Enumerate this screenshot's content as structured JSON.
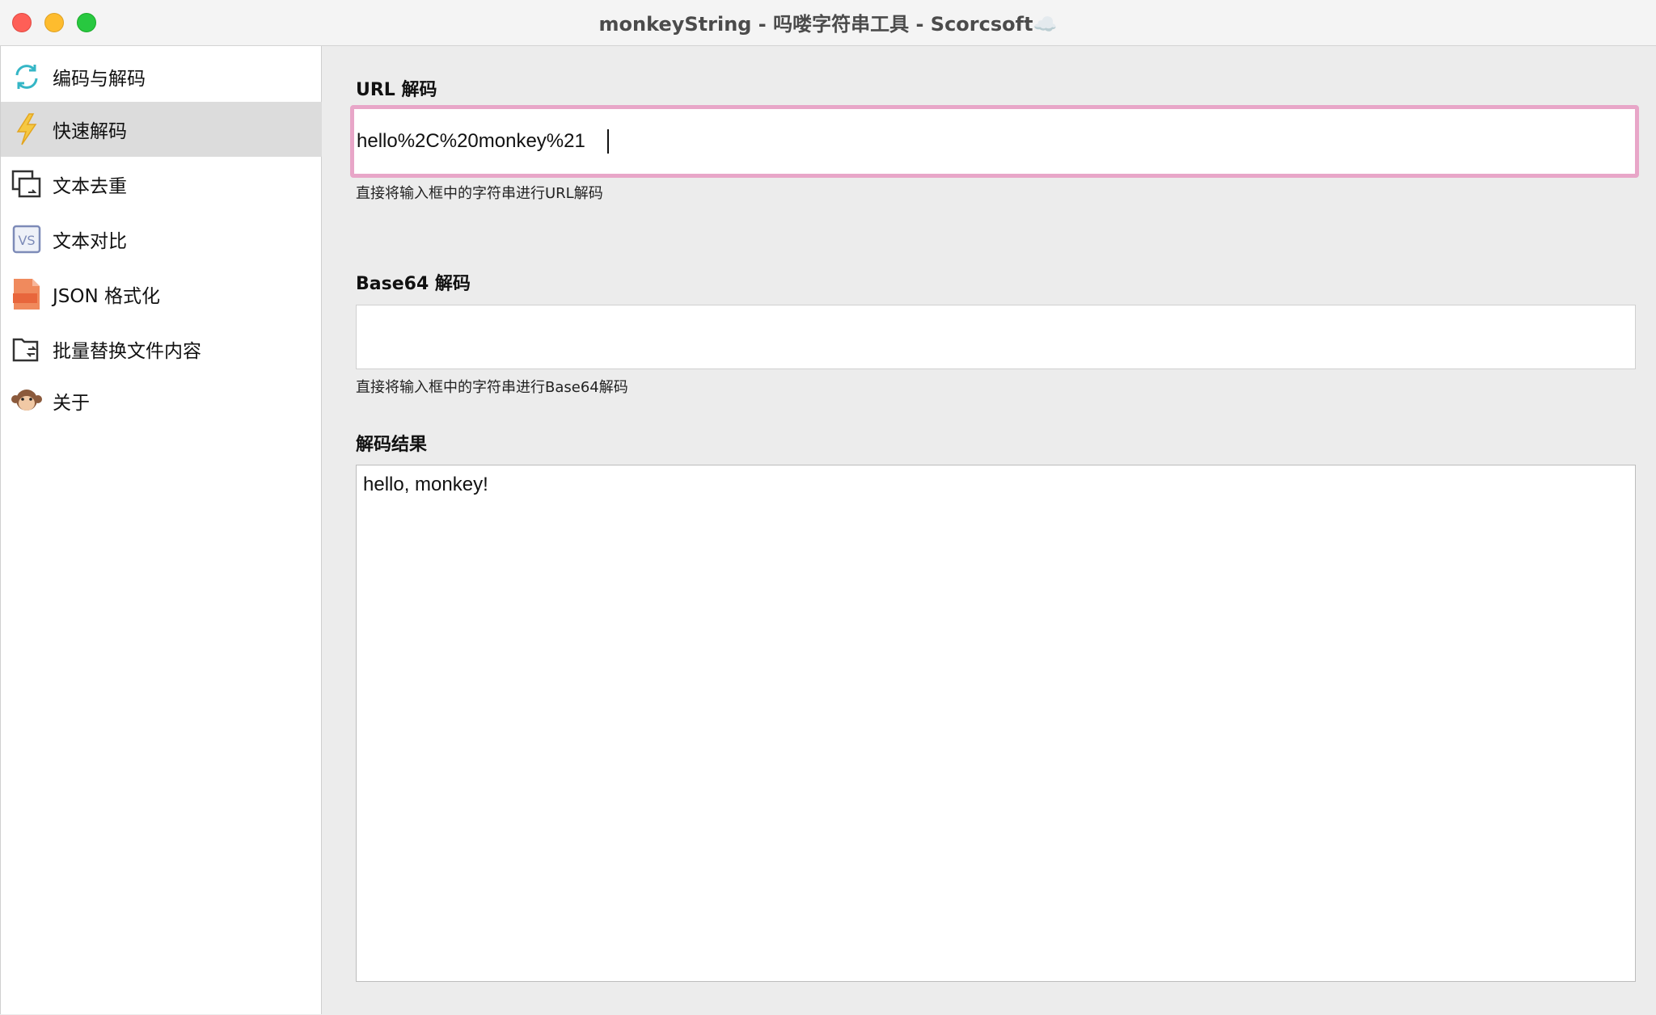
{
  "window": {
    "title": "monkeyString - 吗喽字符串工具 - Scorcsoft☁️"
  },
  "sidebar": {
    "active_index": 1,
    "items": [
      {
        "label": "编码与解码",
        "icon": "refresh-arrows-icon"
      },
      {
        "label": "快速解码",
        "icon": "lightning-icon"
      },
      {
        "label": "文本去重",
        "icon": "duplicate-windows-icon"
      },
      {
        "label": "文本对比",
        "icon": "vs-compare-icon"
      },
      {
        "label": "JSON 格式化",
        "icon": "json-file-icon"
      },
      {
        "label": "批量替换文件内容",
        "icon": "folder-replace-icon"
      },
      {
        "label": "关于",
        "icon": "monkey-face-icon"
      }
    ]
  },
  "main": {
    "url_decode": {
      "title": "URL 解码",
      "value": "hello%2C%20monkey%21",
      "helper": "直接将输入框中的字符串进行URL解码"
    },
    "base64_decode": {
      "title": "Base64 解码",
      "value": "",
      "helper": "直接将输入框中的字符串进行Base64解码"
    },
    "result": {
      "title": "解码结果",
      "value": "hello, monkey!"
    }
  },
  "colors": {
    "focus_ring": "#e8a6c8",
    "active_nav_bg": "#dcdcdc",
    "content_bg": "#ececec"
  }
}
